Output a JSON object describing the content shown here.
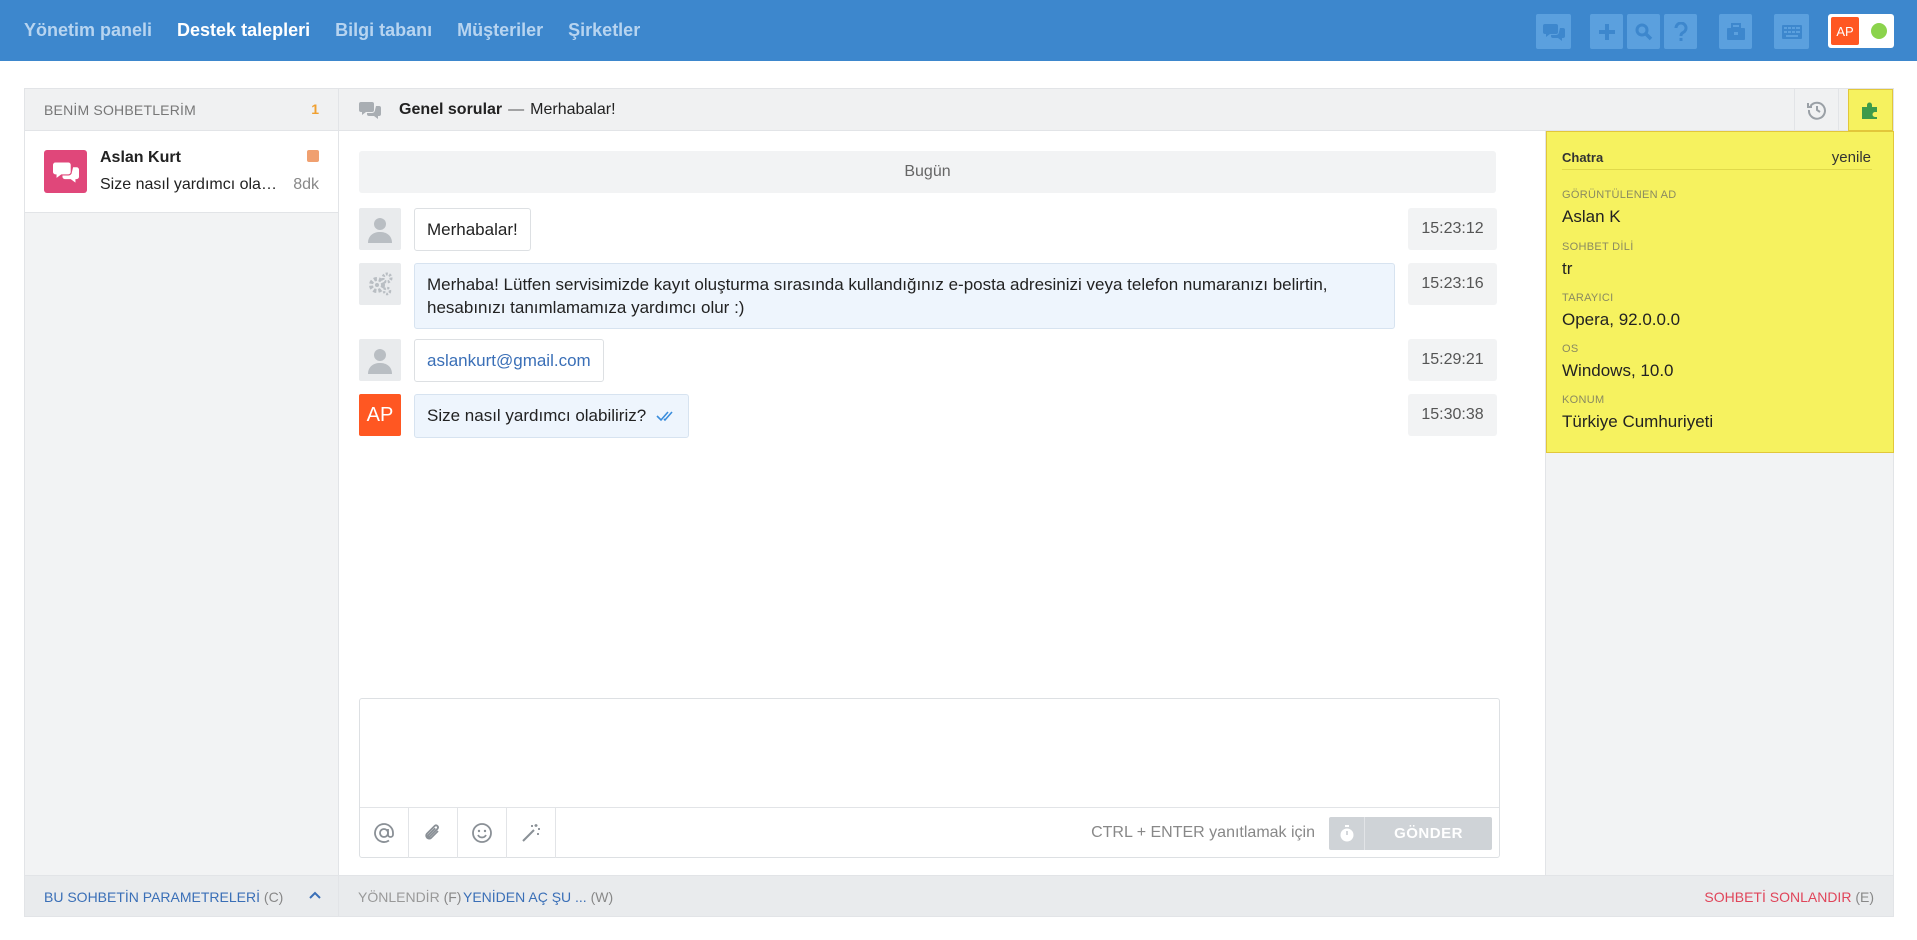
{
  "nav": {
    "items": [
      {
        "label": "Yönetim paneli",
        "active": false
      },
      {
        "label": "Destek talepleri",
        "active": true
      },
      {
        "label": "Bilgi tabanı",
        "active": false
      },
      {
        "label": "Müşteriler",
        "active": false
      },
      {
        "label": "Şirketler",
        "active": false
      }
    ],
    "icons": [
      "chat-bubbles-icon",
      "plus-icon",
      "search-icon",
      "question-icon",
      "briefcase-icon",
      "keyboard-icon"
    ],
    "user_initials": "AP",
    "status_color": "#8bd34c"
  },
  "sidebar": {
    "title": "BENİM SOHBETLERİM",
    "count": "1",
    "chat": {
      "name": "Aslan Kurt",
      "preview": "Size nasıl yardımcı olabiliriz?",
      "time": "8dk",
      "avatar_color": "#e0477a"
    },
    "footer_label": "BU SOHBETİN PARAMETRELERİ",
    "footer_key": "(C)"
  },
  "chat": {
    "header_title": "Genel sorular",
    "header_sep": "—",
    "header_subtitle": "Merhabalar!",
    "day_label": "Bugün",
    "messages": [
      {
        "text": "Merhabalar!",
        "time": "15:23:12",
        "sender": "visitor"
      },
      {
        "text": "Merhaba! Lütfen servisimizde kayıt oluşturma sırasında kullandığınız e-posta adresinizi veya telefon numaranızı belirtin, hesabınızı tanımlamamıza yardımcı olur :)",
        "time": "15:23:16",
        "sender": "bot"
      },
      {
        "text": "aslankurt@gmail.com",
        "time": "15:29:21",
        "sender": "visitor"
      },
      {
        "text": "Size nasıl yardımcı olabiliriz?",
        "time": "15:30:38",
        "sender": "agent",
        "agent_initials": "AP"
      }
    ],
    "composer": {
      "placeholder": "",
      "hint": "CTRL + ENTER yanıtlamak için",
      "send_label": "GÖNDER"
    },
    "footer": {
      "forward_label": "YÖNLENDİR",
      "forward_key": "(F)",
      "reopen_label": "YENİDEN AÇ ŞU ...",
      "reopen_key": "(W)",
      "end_label": "SOHBETİ SONLANDIR",
      "end_key": "(E)"
    }
  },
  "info_panel": {
    "title": "Chatra",
    "refresh_label": "yenile",
    "fields": [
      {
        "label": "GÖRÜNTÜLENEN AD",
        "value": "Aslan K"
      },
      {
        "label": "SOHBET DİLİ",
        "value": "tr"
      },
      {
        "label": "TARAYICI",
        "value": "Opera, 92.0.0.0"
      },
      {
        "label": "OS",
        "value": "Windows, 10.0"
      },
      {
        "label": "KONUM",
        "value": "Türkiye Cumhuriyeti"
      }
    ],
    "accent_color": "#f6f25f"
  },
  "colors": {
    "topbar": "#3d87cd",
    "link": "#3a6fb7",
    "danger": "#e0455a",
    "agent_avatar": "#ff5722"
  }
}
